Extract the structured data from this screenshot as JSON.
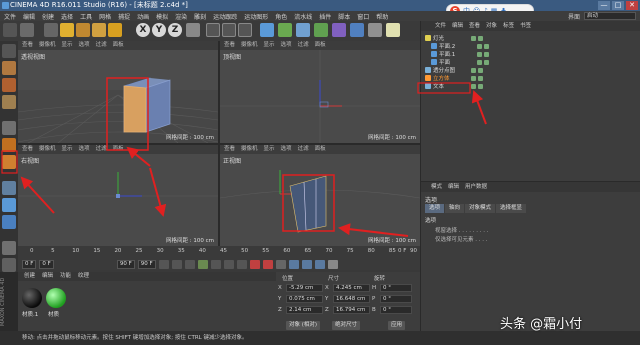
{
  "app": {
    "title": "CINEMA 4D R16.011 Studio (R16) - [未标题 2.c4d *]",
    "window_buttons": [
      "—",
      "□",
      "✕"
    ]
  },
  "menubar": {
    "items": [
      "文件",
      "编辑",
      "创建",
      "选择",
      "工具",
      "网格",
      "捕捉",
      "动画",
      "模拟",
      "渲染",
      "雕刻",
      "运动跟踪",
      "运动图形",
      "角色",
      "流水线",
      "插件",
      "脚本",
      "窗口",
      "帮助"
    ],
    "layout_label": "界面",
    "layout_value": "启动"
  },
  "ime_bar": {
    "logo": "S",
    "label": "中"
  },
  "toolbar": {
    "axis_buttons": [
      "X",
      "Y",
      "Z"
    ]
  },
  "viewports": [
    {
      "name": "透视视图",
      "menu": [
        "查看",
        "摄像机",
        "显示",
        "选项",
        "过滤",
        "面板"
      ],
      "grid": ""
    },
    {
      "name": "顶视图",
      "menu": [
        "查看",
        "摄像机",
        "显示",
        "选项",
        "过滤",
        "面板"
      ],
      "grid": "网格间距 : 100 cm"
    },
    {
      "name": "右视图",
      "menu": [
        "查看",
        "摄像机",
        "显示",
        "选项",
        "过滤",
        "面板"
      ],
      "grid": "网格间距 : 100 cm"
    },
    {
      "name": "正视图",
      "menu": [
        "查看",
        "摄像机",
        "显示",
        "选项",
        "过滤",
        "面板"
      ],
      "grid": "网格间距 : 100 cm"
    }
  ],
  "perspective_grid": "网格间距 : 100 cm",
  "timeline": {
    "ticks": [
      "0",
      "5",
      "10",
      "15",
      "20",
      "25",
      "30",
      "35",
      "40",
      "45",
      "50",
      "55",
      "60",
      "65",
      "70",
      "75",
      "80",
      "85",
      "90"
    ],
    "start_frame": "0 F",
    "current_frame": "0 F",
    "end_frame": "90 F",
    "end_frame_2": "90 F",
    "right_frame": "0 F"
  },
  "material_panel": {
    "menu": [
      "创建",
      "编辑",
      "功能",
      "纹理"
    ],
    "materials": [
      {
        "label": "材质.1",
        "color": "#111111"
      },
      {
        "label": "材质",
        "color": "#2fbf2f"
      }
    ],
    "badge": "MAXON CINEMA 4D"
  },
  "coordinates": {
    "headers": [
      "位置",
      "尺寸",
      "旋转"
    ],
    "rows": [
      {
        "axis": "X",
        "pos": "-5.29 cm",
        "size_axis": "X",
        "size": "4.245 cm",
        "rot_axis": "H",
        "rot": "0 °"
      },
      {
        "axis": "Y",
        "pos": "0.075 cm",
        "size_axis": "Y",
        "size": "16.648 cm",
        "rot_axis": "P",
        "rot": "0 °"
      },
      {
        "axis": "Z",
        "pos": "2.14 cm",
        "size_axis": "Z",
        "size": "16.794 cm",
        "rot_axis": "B",
        "rot": "0 °"
      }
    ],
    "mode_select": "对象 (相对)",
    "size_select": "绝对尺寸",
    "apply_button": "应用"
  },
  "object_manager": {
    "menu": [
      "文件",
      "编辑",
      "查看",
      "对象",
      "标签",
      "书签"
    ],
    "objects": [
      {
        "label": "灯光",
        "color": "#e0d050",
        "selected": false
      },
      {
        "label": "平面.2",
        "color": "#5a9ad8",
        "selected": false
      },
      {
        "label": "平面.1",
        "color": "#5a9ad8",
        "selected": false
      },
      {
        "label": "平面",
        "color": "#5a9ad8",
        "selected": false
      },
      {
        "label": "透分点图",
        "color": "#7ab0d8",
        "selected": false
      },
      {
        "label": "立方体",
        "color": "#ff9933",
        "selected": true
      },
      {
        "label": "文本",
        "color": "#7ab0d8",
        "selected": false
      }
    ]
  },
  "attribute_manager": {
    "menu": [
      "模式",
      "编辑",
      "用户数据"
    ],
    "title": "选项",
    "tabs": [
      "选项",
      "轴向",
      "对象模式",
      "选择框显"
    ],
    "section": "选项",
    "lines": [
      "视窗选择 . . . . . . . . .",
      "仅选择可见元素 . . . ."
    ]
  },
  "statusbar": {
    "text": "移动: 点击并拖动鼠标移动元素。按住 SHIFT 键增加选择对象; 按住 CTRL 键减少选择对象。"
  },
  "watermark": "头条 @霜小付"
}
